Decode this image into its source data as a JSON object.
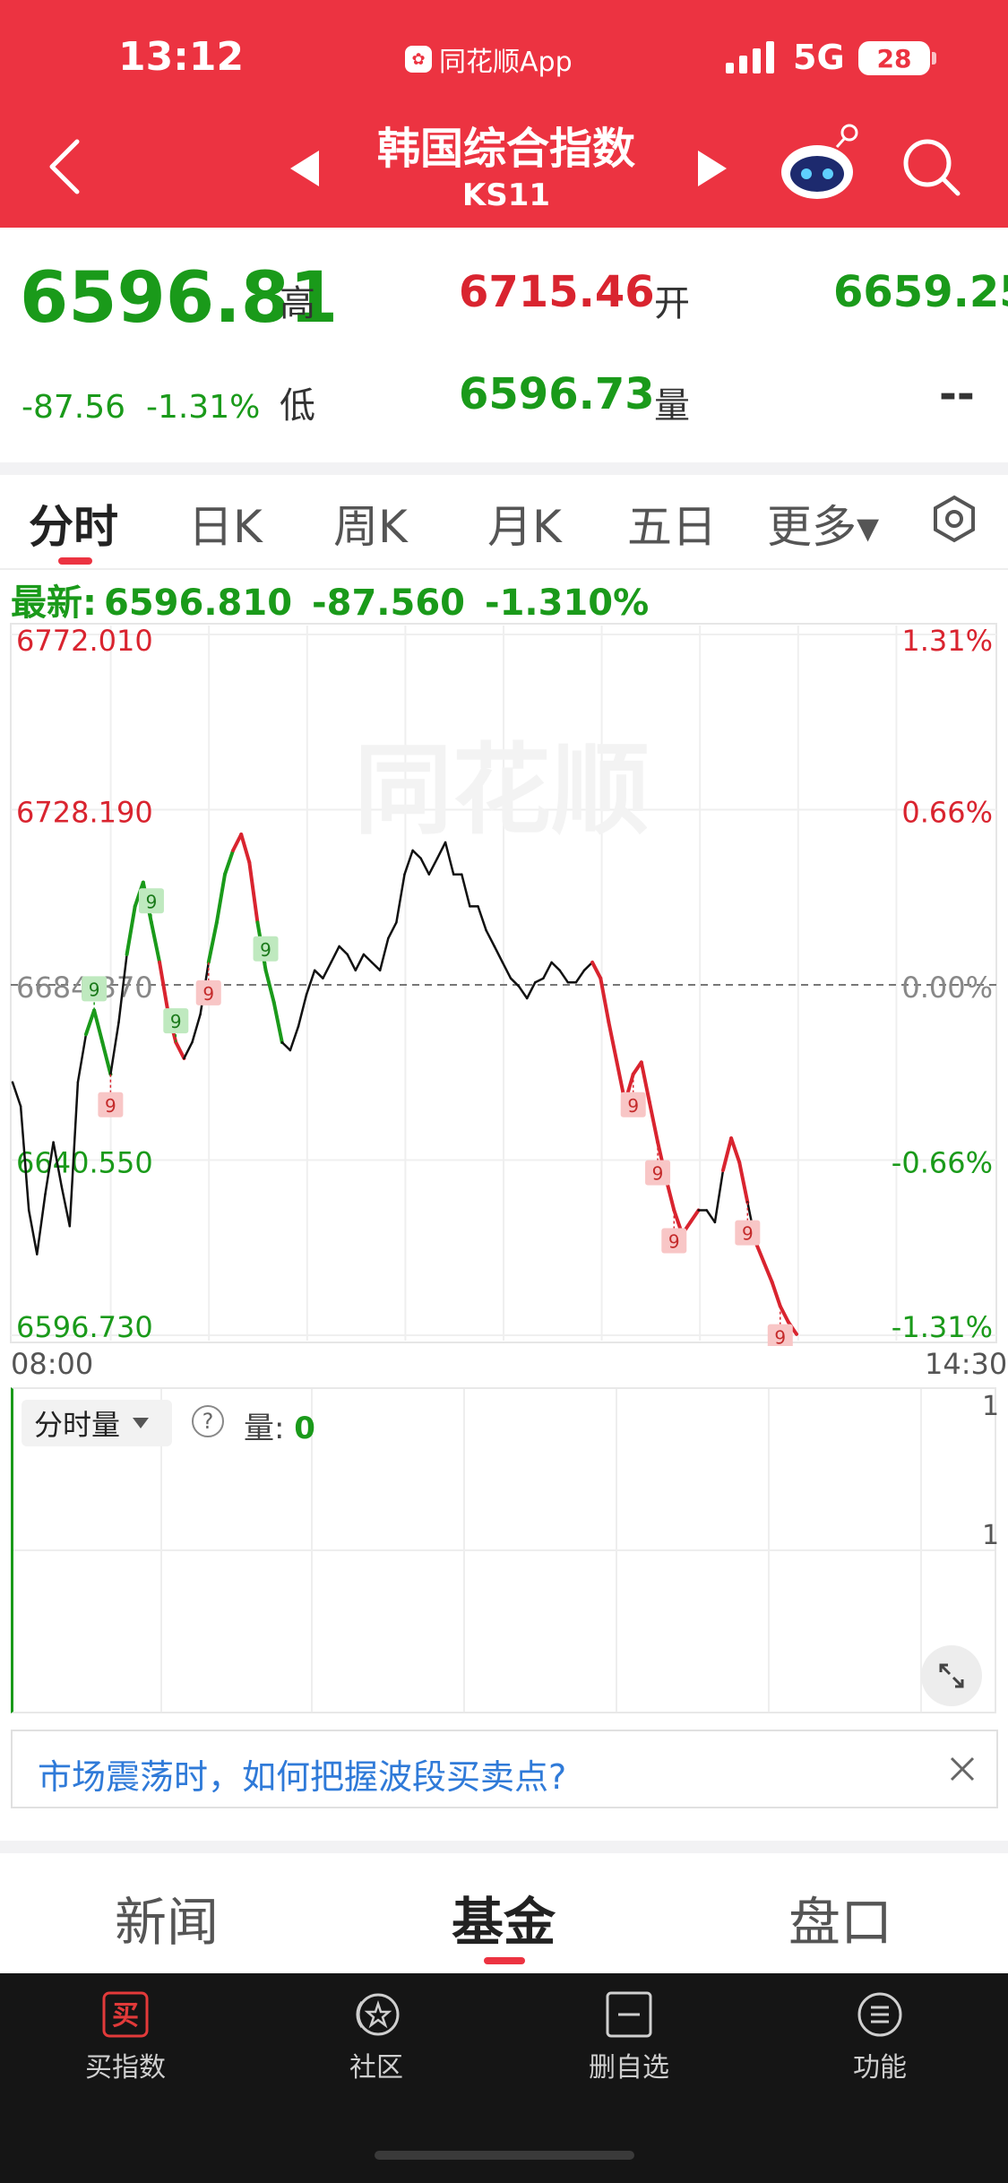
{
  "status": {
    "time": "13:12",
    "app_label": "同花顺App",
    "network": "5G",
    "battery": "28"
  },
  "nav": {
    "title": "韩国综合指数",
    "code": "KS11"
  },
  "quote": {
    "price": "6596.81",
    "change": "-87.56",
    "change_pct": "-1.31%",
    "high_label": "高",
    "high": "6715.46",
    "open_label": "开",
    "open": "6659.25",
    "low_label": "低",
    "low": "6596.73",
    "volume_label": "量",
    "volume": "--"
  },
  "tabs": [
    {
      "label": "分时",
      "active": true
    },
    {
      "label": "日K"
    },
    {
      "label": "周K"
    },
    {
      "label": "月K"
    },
    {
      "label": "五日"
    },
    {
      "label": "更多▾"
    }
  ],
  "latest": {
    "label": "最新:",
    "price": "6596.810",
    "change": "-87.560",
    "pct": "-1.310%"
  },
  "chart_data": {
    "type": "line",
    "watermark": "同花顺",
    "y_ticks_left": [
      "6772.010",
      "6728.190",
      "6684.370",
      "6640.550",
      "6596.730"
    ],
    "y_ticks_right": [
      "1.31%",
      "0.66%",
      "0.00%",
      "-0.66%",
      "-1.31%"
    ],
    "ylim": [
      6596.73,
      6772.01
    ],
    "baseline": 6684.37,
    "x_start_label": "08:00",
    "x_end_label": "14:30",
    "series": [
      {
        "values": [
          6660,
          6654,
          6628,
          6617,
          6632,
          6645,
          6634,
          6624,
          6660,
          6672,
          6678,
          6670,
          6662,
          6675,
          6692,
          6704,
          6710,
          6700,
          6690,
          6678,
          6670,
          6666,
          6670,
          6677,
          6690,
          6700,
          6712,
          6718,
          6722,
          6715,
          6700,
          6688,
          6680,
          6670,
          6668,
          6674,
          6682,
          6688,
          6686,
          6690,
          6694,
          6692,
          6688,
          6692,
          6690,
          6688,
          6696,
          6700,
          6712,
          6718,
          6716,
          6712,
          6716,
          6720,
          6712,
          6712,
          6704,
          6704,
          6698,
          6694,
          6690,
          6686,
          6684,
          6681,
          6685,
          6686,
          6690,
          6688,
          6685,
          6685,
          6688,
          6690,
          6686,
          6675,
          6665,
          6655,
          6662,
          6665,
          6655,
          6645,
          6636,
          6628,
          6622,
          6625,
          6628,
          6628,
          6625,
          6638,
          6646,
          6640,
          6630,
          6620,
          6615,
          6610,
          6604,
          6600,
          6597
        ]
      }
    ],
    "markers": [
      {
        "label": "9",
        "type": "up"
      },
      {
        "label": "9",
        "type": "down"
      },
      {
        "label": "9",
        "type": "up"
      },
      {
        "label": "9",
        "type": "up"
      },
      {
        "label": "9",
        "type": "down"
      },
      {
        "label": "9",
        "type": "up"
      },
      {
        "label": "9",
        "type": "down"
      },
      {
        "label": "9",
        "type": "down"
      },
      {
        "label": "9",
        "type": "down"
      },
      {
        "label": "9",
        "type": "down"
      },
      {
        "label": "9",
        "type": "down"
      }
    ]
  },
  "volume": {
    "selector": "分时量",
    "help_icon": "?",
    "label": "量:",
    "value": "0",
    "axis_top": "1",
    "axis_mid": "1"
  },
  "banner": {
    "text": "市场震荡时，如何把握波段买卖点?"
  },
  "bottom_tabs": [
    {
      "label": "新闻"
    },
    {
      "label": "基金",
      "active": true
    },
    {
      "label": "盘口"
    }
  ],
  "toolbar": [
    {
      "label": "买指数",
      "icon": "buy-icon",
      "glyph": "买"
    },
    {
      "label": "社区",
      "icon": "community-icon"
    },
    {
      "label": "删自选",
      "icon": "remove-watchlist-icon"
    },
    {
      "label": "功能",
      "icon": "menu-icon"
    }
  ],
  "colors": {
    "header": "#ec3341",
    "up": "#d9242f",
    "down": "#1a9a1a",
    "link": "#2f7ad8"
  }
}
